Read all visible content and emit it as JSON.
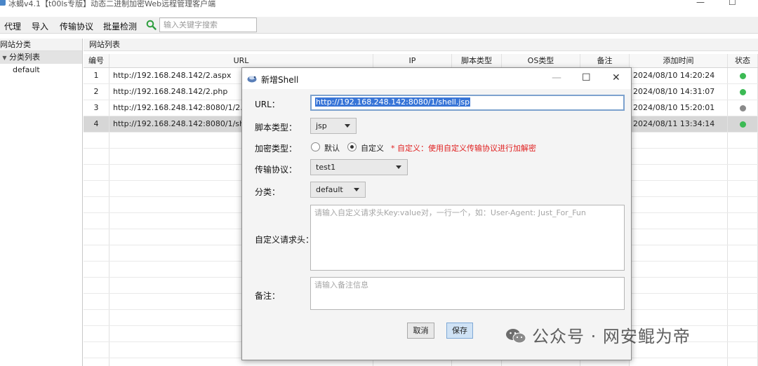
{
  "app": {
    "title": "冰蝎v4.1【t00ls专版】动态二进制加密Web远程管理客户端",
    "minimize": "—",
    "maximize": "☐"
  },
  "toolbar": {
    "items": [
      "代理",
      "导入",
      "传输协议",
      "批量检测"
    ],
    "search_placeholder": "输入关键字搜索",
    "search_icon": "magnifier-icon"
  },
  "left": {
    "header": "网站分类",
    "category_label": "分类列表",
    "items": [
      "default"
    ]
  },
  "right": {
    "header": "网站列表"
  },
  "table": {
    "columns": [
      "编号",
      "URL",
      "IP",
      "脚本类型",
      "OS类型",
      "备注",
      "添加时间",
      "状态"
    ],
    "rows": [
      {
        "num": "1",
        "url": "http://192.168.248.142/2.aspx",
        "time": "2024/08/10 14:20:24",
        "status_color": "#3cba54"
      },
      {
        "num": "2",
        "url": "http://192.168.248.142/2.php",
        "time": "2024/08/10 14:31:07",
        "status_color": "#3cba54"
      },
      {
        "num": "3",
        "url": "http://192.168.248.142:8080/1/2.jsp",
        "time": "2024/08/10 15:20:01",
        "status_color": "#8a8a8a"
      },
      {
        "num": "4",
        "url": "http://192.168.248.142:8080/1/shell.jsp",
        "time": "2024/08/11 13:34:14",
        "status_color": "#3cba54"
      }
    ]
  },
  "dialog": {
    "title": "新增Shell",
    "icon": "shell-icon",
    "min": "—",
    "max": "☐",
    "close": "✕",
    "url_label": "URL：",
    "url_value": "http://192.168.248.142:8080/1/shell.jsp",
    "script_label": "脚本类型：",
    "script_value": "jsp",
    "encrypt_label": "加密类型：",
    "encrypt_options": [
      "默认",
      "自定义"
    ],
    "encrypt_selected": "自定义",
    "encrypt_hint": "* 自定义：使用自定义传输协议进行加解密",
    "protocol_label": "传输协议：",
    "protocol_value": "test1",
    "category_label": "分类：",
    "category_value": "default",
    "headers_label": "自定义请求头：",
    "headers_placeholder": "请输入自定义请求头Key:value对，一行一个，如：User-Agent: Just_For_Fun",
    "remark_label": "备注：",
    "remark_placeholder": "请输入备注信息",
    "cancel": "取消",
    "save": "保存"
  },
  "watermark": {
    "text": "公众号 · 网安鲲为帝",
    "icon": "wechat-icon"
  }
}
